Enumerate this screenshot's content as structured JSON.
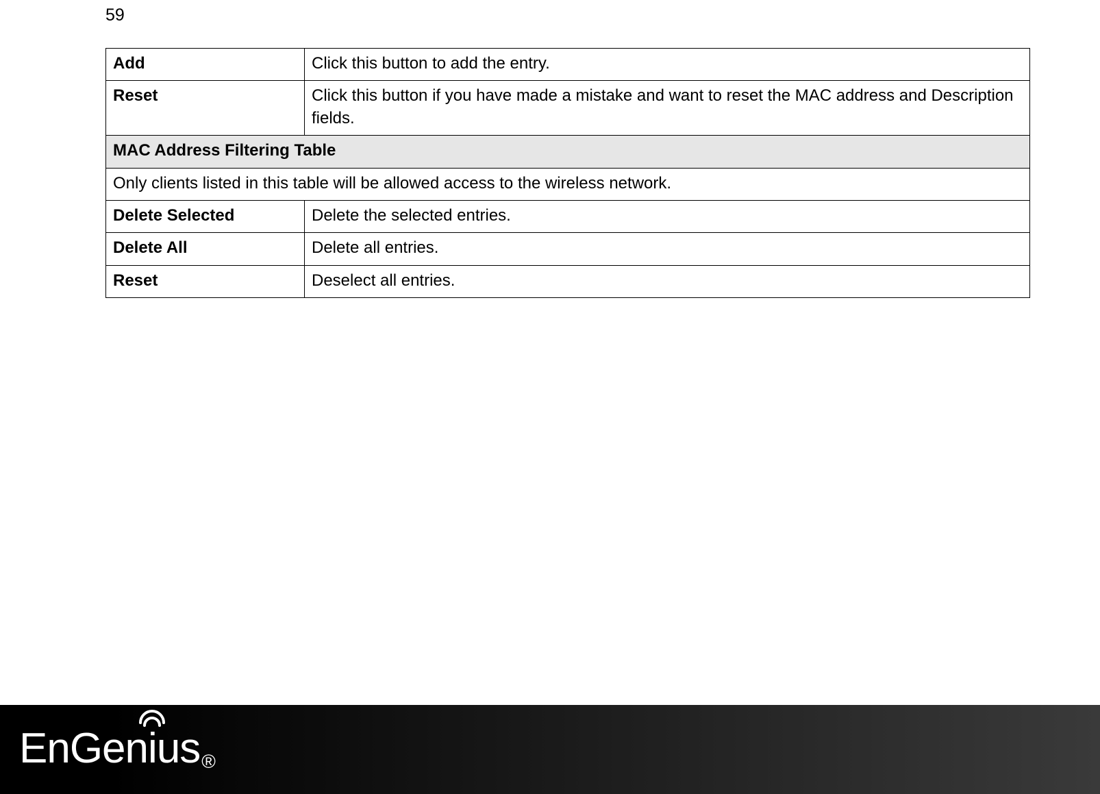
{
  "page_number": "59",
  "table": {
    "rows": [
      {
        "label": "Add",
        "desc": "Click this button to add the entry."
      },
      {
        "label": "Reset",
        "desc": "Click this button if you have made a mistake and want to reset the MAC address and Description fields."
      }
    ],
    "section_header": "MAC Address Filtering Table",
    "section_desc": "Only clients listed in this table will be allowed access to the wireless network.",
    "rows2": [
      {
        "label": "Delete Selected",
        "desc": "Delete the selected entries."
      },
      {
        "label": "Delete All",
        "desc": "Delete all entries."
      },
      {
        "label": "Reset",
        "desc": "Deselect all entries."
      }
    ]
  },
  "footer": {
    "brand": "EnGenius",
    "registered": "®"
  }
}
